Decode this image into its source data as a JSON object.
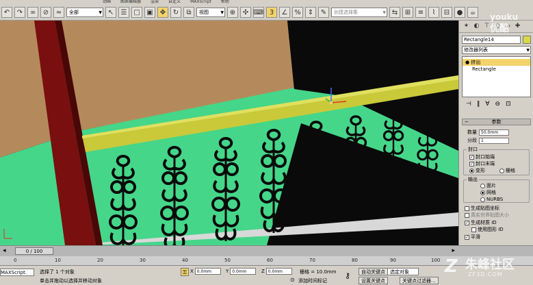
{
  "menu": {
    "items": [
      "动画",
      "图表编辑器",
      "渲染",
      "自定义",
      "MAXScript",
      "帮助"
    ]
  },
  "toolbar": {
    "selection_filter": "全部",
    "ref_coord": "视图",
    "named_selection_placeholder": "创建选择集"
  },
  "command_panel": {
    "object_name": "Rectangle14",
    "modifier_list": "修改器列表",
    "stack": {
      "selected": "挤出",
      "base": "Rectangle"
    },
    "params": {
      "title": "参数",
      "amount_label": "数量",
      "amount_value": "50.0mm",
      "segments_label": "分段",
      "segments_value": "1",
      "capping_title": "封口",
      "cap_start": "封口始端",
      "cap_end": "封口末端",
      "morph": "变形",
      "grid": "栅格",
      "output_title": "输出",
      "patch": "面片",
      "mesh": "网格",
      "nurbs": "NURBS",
      "gen_map": "生成贴图坐标",
      "real_world": "真实世界贴图大小",
      "gen_mat": "生成材质 ID",
      "use_shape_ids": "使用图形 ID",
      "smooth": "平滑"
    }
  },
  "timeline": {
    "frame": "0 / 100",
    "ticks": [
      "0",
      "10",
      "20",
      "30",
      "40",
      "50",
      "60",
      "70",
      "80",
      "90",
      "100"
    ]
  },
  "status": {
    "script_label": "MAXScript.",
    "selected": "选择了 1 个对象",
    "prompt": "单击并拖动以选择并移动对象",
    "x_value": "0.0mm",
    "y_value": "0.0mm",
    "z_value": "0.0mm",
    "grid": "栅格 = 10.0mm",
    "add_time_tag": "添加时间标记",
    "auto_key": "自动关键点",
    "selected_obj": "选定对象",
    "set_key": "设置关键点",
    "key_filters": "关键点过滤器..."
  },
  "watermarks": {
    "youku_latin": "youku",
    "youku_cn": "优酷",
    "zf_cn": "朱峰社区",
    "zf_url": "ZF3D.COM"
  },
  "colors": {
    "wall": "#b48a5c",
    "floor": "#45d68a",
    "railing": "#c9c93a",
    "baluster": "#0a0a0a",
    "post": "#7a0f0f",
    "highlight": "#f3d36a"
  }
}
